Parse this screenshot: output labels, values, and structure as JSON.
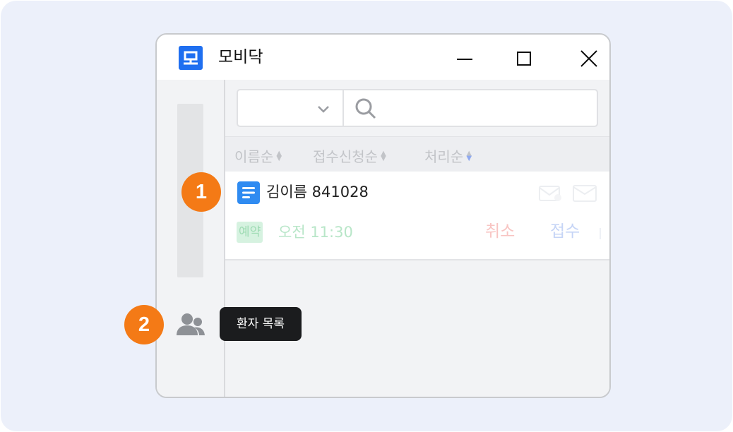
{
  "window": {
    "title": "모비닥",
    "logo_icon": "mobidoc-logo-icon",
    "controls": [
      "minimize-icon",
      "maximize-icon",
      "close-icon"
    ]
  },
  "search": {
    "select_value": "",
    "input_value": "",
    "placeholder": ""
  },
  "sort": {
    "by_name": "이름순",
    "by_received": "접수신청순",
    "by_processed": "처리순"
  },
  "patient": {
    "label": "김이름 841028",
    "tag": "예약",
    "time": "오전 11:30",
    "cancel_label": "취소",
    "accept_label": "접수"
  },
  "sidebar": {
    "patients_icon": "users-icon"
  },
  "tooltip": {
    "text": "환자 목록"
  },
  "badges": {
    "step1": "1",
    "step2": "2"
  },
  "colors": {
    "brand": "#1f6ff0",
    "badge": "#f47a16",
    "tooltip_bg": "#1b1c1e"
  }
}
